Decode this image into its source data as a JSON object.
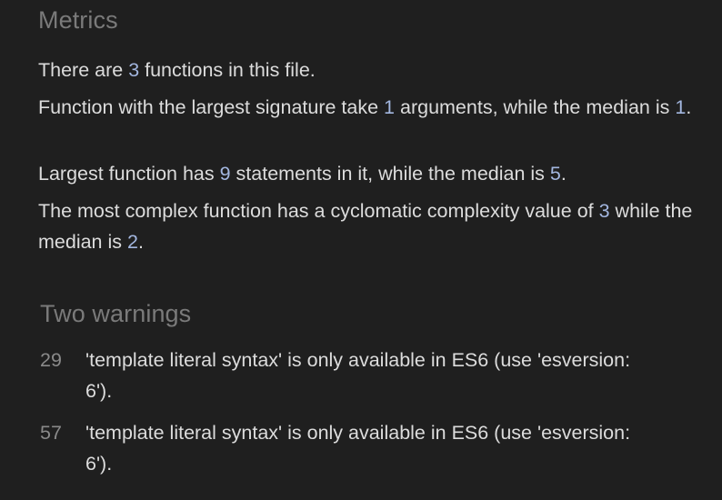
{
  "metrics": {
    "title": "Metrics",
    "line1": {
      "pre": "There are ",
      "num": "3",
      "post": " functions in this file."
    },
    "line2": {
      "pre": "Function with the largest signature take ",
      "num1": "1",
      "mid": " arguments, while the median is ",
      "num2": "1",
      "post": "."
    },
    "line3": {
      "pre": "Largest function has ",
      "num1": "9",
      "mid": " statements in it, while the median is ",
      "num2": "5",
      "post": "."
    },
    "line4": {
      "pre": "The most complex function has a cyclomatic complexity value of ",
      "num1": "3",
      "mid": " while the median is ",
      "num2": "2",
      "post": "."
    }
  },
  "warnings": {
    "title": "Two warnings",
    "items": [
      {
        "line": "29",
        "message": "'template literal syntax' is only available in ES6 (use 'esversion: 6')."
      },
      {
        "line": "57",
        "message": "'template literal syntax' is only available in ES6 (use 'esversion: 6')."
      }
    ]
  },
  "colors": {
    "background": "#1f1f1f",
    "text": "#dcdcdc",
    "heading": "#7a7a7a",
    "number": "#a3b7e0",
    "line_number": "#8a8a8a"
  }
}
